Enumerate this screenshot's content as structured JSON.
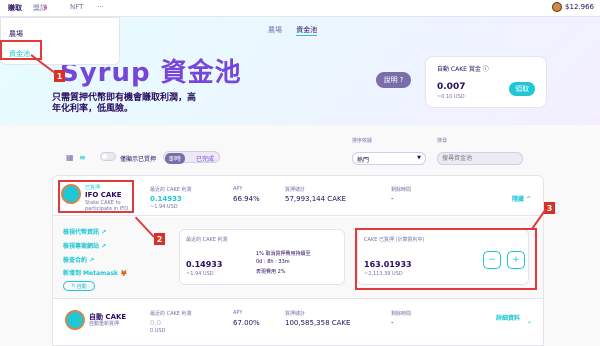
{
  "nav": {
    "items": [
      {
        "label": "賺取",
        "active": true
      },
      {
        "label": "獎詳"
      },
      {
        "label": "NFT"
      },
      {
        "label": "···"
      }
    ],
    "balance": "$12.966"
  },
  "dropdown": {
    "items": [
      {
        "label": "農場"
      },
      {
        "label": "資金池",
        "selected": true
      }
    ]
  },
  "subtabs": [
    {
      "label": "農場"
    },
    {
      "label": "資金池",
      "active": true
    }
  ],
  "hero": {
    "title": "Syrup 資金池",
    "subtitle": "只需質押代幣即有機會賺取利潤，高年化利率，低風險。",
    "help_label": "說明",
    "auto_card": {
      "label": "自動 CAKE 賞金",
      "value": "0.007",
      "usd": "~0.10 USD",
      "claim_label": "領取"
    }
  },
  "filters": {
    "staked_only_label": "僅顯示已質押",
    "tabs": [
      "即時",
      "已完成"
    ],
    "sort_label": "排序依據",
    "sort_value": "熱門",
    "search_label": "搜尋",
    "search_placeholder": "搜尋資金池"
  },
  "pool1": {
    "tag": "已質押",
    "name": "IFO CAKE",
    "desc": "Stake CAKE to participate in IFO",
    "cols": [
      {
        "h": "最近的 CAKE 利潤",
        "v": "0.14933",
        "s": "~1.94 USD"
      },
      {
        "h": "APY",
        "v": "66.94%"
      },
      {
        "h": "質押總計",
        "v": "57,993,144 CAKE"
      },
      {
        "h": "剩餘時間",
        "v": "-"
      }
    ],
    "hide_label": "隱藏 ^"
  },
  "expanded": {
    "links": [
      "檢視代幣資訊",
      "檢視專案網站",
      "檢查合約",
      "新增到 Metamask"
    ],
    "auto_label": "自動",
    "box1": {
      "title": "最近的 CAKE 利潤",
      "value": "0.14933",
      "usd": "~1.94 USD",
      "fee_lines": [
        "1% 取消質押費用持續至",
        "0d : 8h : 33m",
        "表現費用 2%"
      ]
    },
    "box2": {
      "title": "CAKE 已質押 (計算質利中)",
      "value": "163.01933",
      "usd": "~2,113.39 USD",
      "minus": "−",
      "plus": "+"
    }
  },
  "pool2": {
    "name": "自動 CAKE",
    "desc": "自動重新質押",
    "cols": [
      {
        "h": "最近的 CAKE 利潤",
        "v": "0.0",
        "s": "0 USD"
      },
      {
        "h": "APY",
        "v": "67.00%"
      },
      {
        "h": "質押總計",
        "v": "100,585,358 CAKE"
      },
      {
        "h": "剩餘時間",
        "v": "-"
      }
    ],
    "details_label": "詳細資料"
  },
  "annotations": [
    "1",
    "2",
    "3"
  ],
  "colors": {
    "accent": "#1fc7d4",
    "primary": "#7645d9",
    "annotation": "#e03a3a"
  }
}
